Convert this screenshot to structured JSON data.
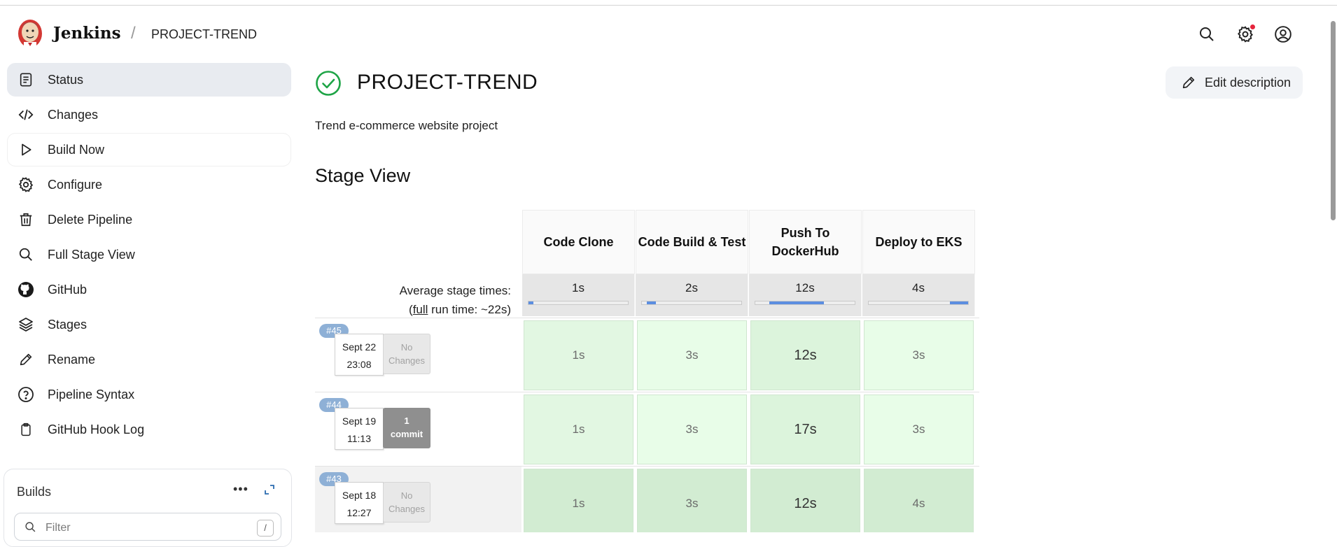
{
  "header": {
    "brand": "Jenkins",
    "crumb_sep": "/",
    "breadcrumb": "PROJECT-TREND",
    "icons": [
      "search-icon",
      "gear-icon",
      "account-icon"
    ],
    "notification_color": "#e5243b"
  },
  "sidebar": {
    "items": [
      {
        "label": "Status",
        "icon": "status-doc-icon",
        "active": true
      },
      {
        "label": "Changes",
        "icon": "code-icon"
      },
      {
        "label": "Build Now",
        "icon": "play-icon"
      },
      {
        "label": "Configure",
        "icon": "gear-icon"
      },
      {
        "label": "Delete Pipeline",
        "icon": "trash-icon"
      },
      {
        "label": "Full Stage View",
        "icon": "search-icon"
      },
      {
        "label": "GitHub",
        "icon": "github-icon"
      },
      {
        "label": "Stages",
        "icon": "layers-icon"
      },
      {
        "label": "Rename",
        "icon": "pencil-icon"
      },
      {
        "label": "Pipeline Syntax",
        "icon": "help-icon"
      },
      {
        "label": "GitHub Hook Log",
        "icon": "clipboard-icon"
      }
    ],
    "builds": {
      "title": "Builds",
      "more": "•••",
      "filter_placeholder": "Filter",
      "filter_key": "/"
    }
  },
  "main": {
    "title": "PROJECT-TREND",
    "status": "success",
    "status_color": "#1ea446",
    "edit_label": "Edit description",
    "description": "Trend e-commerce website project",
    "stage_view_heading": "Stage View"
  },
  "stage_view": {
    "avg_label_line1": "Average stage times:",
    "avg_label_open": "(",
    "avg_label_full": "full",
    "avg_label_rest": " run time: ~22s)",
    "stages": [
      {
        "name": "Code Clone",
        "avg": "1s",
        "bar_fraction": 0.05
      },
      {
        "name": "Code Build & Test",
        "avg": "2s",
        "bar_fraction": 0.09
      },
      {
        "name": "Push To DockerHub",
        "avg": "12s",
        "bar_fraction": 0.55
      },
      {
        "name": "Deploy to EKS",
        "avg": "4s",
        "bar_fraction": 0.18
      }
    ],
    "builds": [
      {
        "number": "#45",
        "date": "Sept 22",
        "time": "23:08",
        "changes_line1": "No",
        "changes_line2": "Changes",
        "has_commits": false,
        "durations": [
          "1s",
          "3s",
          "12s",
          "3s"
        ]
      },
      {
        "number": "#44",
        "date": "Sept 19",
        "time": "11:13",
        "changes_line1": "1",
        "changes_line2": "commit",
        "has_commits": true,
        "durations": [
          "1s",
          "3s",
          "17s",
          "3s"
        ]
      },
      {
        "number": "#43",
        "date": "Sept 18",
        "time": "12:27",
        "changes_line1": "No",
        "changes_line2": "Changes",
        "has_commits": false,
        "durations": [
          "1s",
          "3s",
          "12s",
          "4s"
        ]
      }
    ],
    "bar_color": "#5c8ee0",
    "success_cell_color": "#e2f7e2"
  }
}
